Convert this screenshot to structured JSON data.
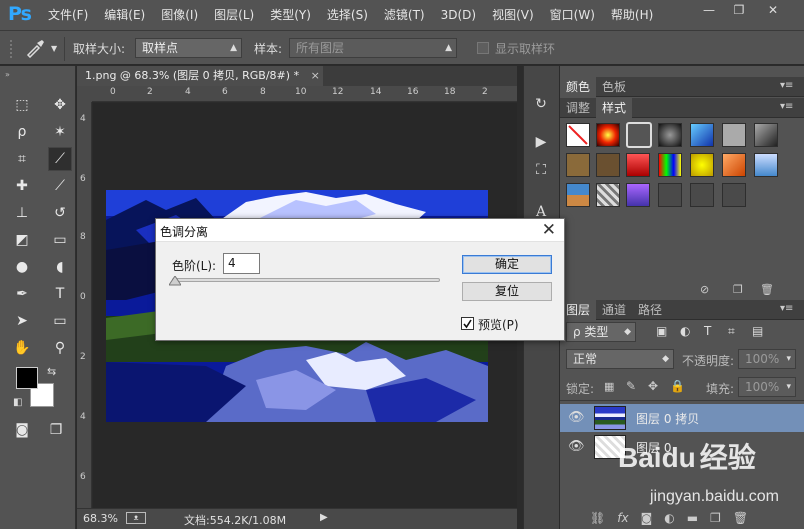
{
  "app": {
    "logo": "Ps"
  },
  "menu": [
    "文件(F)",
    "编辑(E)",
    "图像(I)",
    "图层(L)",
    "类型(Y)",
    "选择(S)",
    "滤镜(T)",
    "3D(D)",
    "视图(V)",
    "窗口(W)",
    "帮助(H)"
  ],
  "window_controls": {
    "minimize": "—",
    "restore": "❐",
    "close": "✕"
  },
  "options": {
    "sample_size_label": "取样大小:",
    "sample_size_value": "取样点",
    "sample_label": "样本:",
    "sample_value": "所有图层",
    "show_ring_label": "显示取样环"
  },
  "document": {
    "tab_title": "1.png @ 68.3% (图层 0 拷贝, RGB/8#) *",
    "tab_close": "×",
    "ruler_top": [
      "0",
      "2",
      "4",
      "6",
      "8",
      "10",
      "12",
      "14",
      "16",
      "18",
      "2"
    ],
    "ruler_left": [
      "4",
      "6",
      "8",
      "0",
      "2",
      "4",
      "6"
    ],
    "zoom": "68.3%",
    "doc_info": "文档:554.2K/1.08M"
  },
  "dialog": {
    "title": "色调分离",
    "close": "✕",
    "levels_label": "色阶(L):",
    "levels_value": "4",
    "ok_label": "确定",
    "reset_label": "复位",
    "preview_label": "预览(P)",
    "preview_checked": true
  },
  "panels": {
    "color_tabs": [
      "颜色",
      "色板"
    ],
    "adjust_tabs": [
      "调整",
      "样式"
    ],
    "layers_tabs": [
      "图层",
      "通道",
      "路径"
    ],
    "kind_label": "ρ 类型",
    "blend_mode": "正常",
    "opacity_label": "不透明度:",
    "opacity_value": "100%",
    "lock_label": "锁定:",
    "fill_label": "填充:",
    "fill_value": "100%",
    "layers": [
      {
        "name": "图层 0 拷贝",
        "selected": true
      },
      {
        "name": "图层 0",
        "selected": false
      }
    ],
    "footer_icons": [
      "link-icon",
      "fx-icon",
      "mask-icon",
      "adjustment-icon",
      "folder-icon",
      "new-layer-icon",
      "trash-icon"
    ]
  },
  "watermark": {
    "brand": "Baidu",
    "brand_cn": "经验",
    "url": "jingyan.baidu.com"
  },
  "colors": {
    "accent": "#31a8ff",
    "panel": "#535353",
    "canvas": "#282828",
    "selected_layer": "#7390b8"
  }
}
